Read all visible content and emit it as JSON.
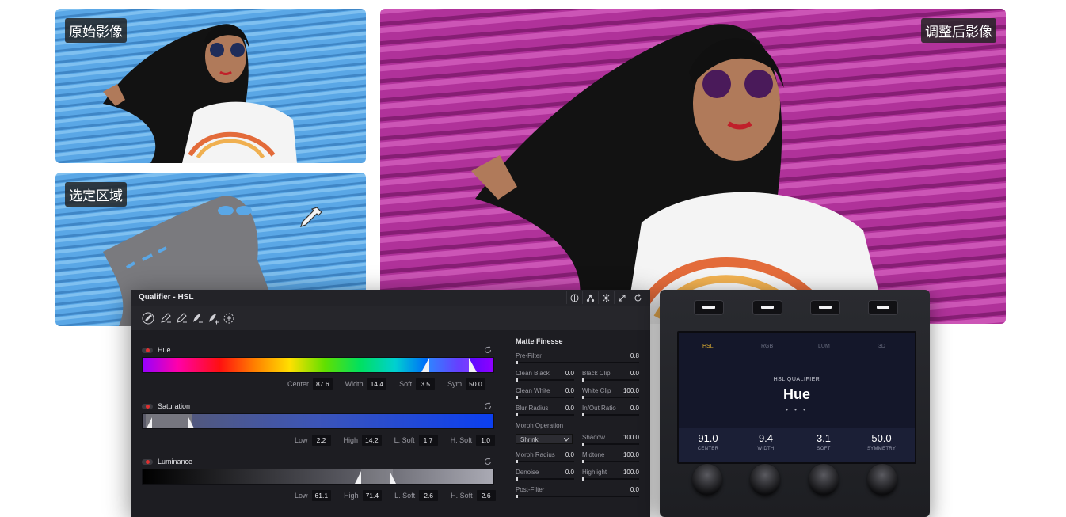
{
  "photos": {
    "original_label": "原始影像",
    "selection_label": "选定区域",
    "adjusted_label": "调整后影像"
  },
  "qualifier": {
    "title": "Qualifier - HSL",
    "header_icons": [
      "globe-icon",
      "nodes-icon",
      "sun-icon",
      "expand-icon",
      "reset-icon"
    ],
    "tool_icons": [
      "eyedropper-icon",
      "eyedropper-minus-icon",
      "eyedropper-plus-icon",
      "feather-minus-icon",
      "feather-plus-icon",
      "invert-icon"
    ],
    "hue": {
      "label": "Hue",
      "center_label": "Center",
      "center": "87.6",
      "width_label": "Width",
      "width": "14.4",
      "soft_label": "Soft",
      "soft": "3.5",
      "sym_label": "Sym",
      "sym": "50.0"
    },
    "saturation": {
      "label": "Saturation",
      "low_label": "Low",
      "low": "2.2",
      "high_label": "High",
      "high": "14.2",
      "lsoft_label": "L. Soft",
      "lsoft": "1.7",
      "hsoft_label": "H. Soft",
      "hsoft": "1.0"
    },
    "luminance": {
      "label": "Luminance",
      "low_label": "Low",
      "low": "61.1",
      "high_label": "High",
      "high": "71.4",
      "lsoft_label": "L. Soft",
      "lsoft": "2.6",
      "hsoft_label": "H. Soft",
      "hsoft": "2.6"
    }
  },
  "matte": {
    "title": "Matte Finesse",
    "pre_filter_label": "Pre-Filter",
    "pre_filter": "0.8",
    "clean_black_label": "Clean Black",
    "clean_black": "0.0",
    "black_clip_label": "Black Clip",
    "black_clip": "0.0",
    "clean_white_label": "Clean White",
    "clean_white": "0.0",
    "white_clip_label": "White Clip",
    "white_clip": "100.0",
    "blur_radius_label": "Blur Radius",
    "blur_radius": "0.0",
    "inout_ratio_label": "In/Out Ratio",
    "inout_ratio": "0.0",
    "morph_operation_label": "Morph Operation",
    "morph_operation": "Shrink",
    "shadow_label": "Shadow",
    "shadow": "100.0",
    "morph_radius_label": "Morph Radius",
    "morph_radius": "0.0",
    "midtone_label": "Midtone",
    "midtone": "100.0",
    "denoise_label": "Denoise",
    "denoise": "0.0",
    "highlight_label": "Highlight",
    "highlight": "100.0",
    "post_filter_label": "Post-Filter",
    "post_filter": "0.0"
  },
  "hardware": {
    "tabs": [
      "HSL",
      "RGB",
      "LUM",
      "3D"
    ],
    "active_tab": "HSL",
    "subtitle": "HSL QUALIFIER",
    "mode": "Hue",
    "pager": "• • •",
    "readouts": [
      {
        "value": "91.0",
        "caption": "CENTER"
      },
      {
        "value": "9.4",
        "caption": "WIDTH"
      },
      {
        "value": "3.1",
        "caption": "SOFT"
      },
      {
        "value": "50.0",
        "caption": "SYMMETRY"
      }
    ]
  },
  "colors": {
    "wall_blue": "#5aa7e6",
    "wall_magenta": "#b0329a",
    "panel_bg": "#1d1d22",
    "accent_red": "#e03030",
    "hw_tab_active": "#e0b030"
  }
}
